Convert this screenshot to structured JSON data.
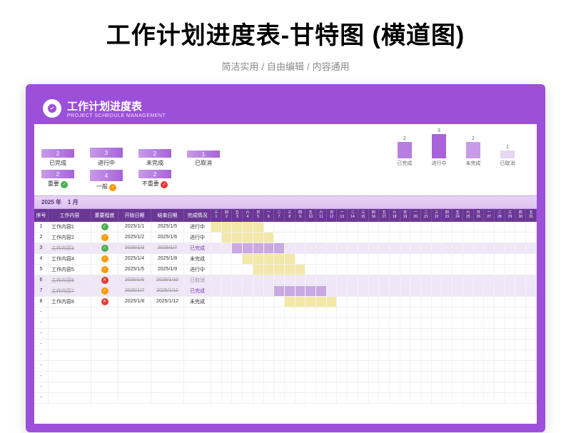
{
  "page": {
    "title": "工作计划进度表-甘特图 (横道图)",
    "subtitle": [
      "简洁实用",
      "自由编辑",
      "内容通用"
    ]
  },
  "header": {
    "title": "工作计划进度表",
    "subtitle": "PROJECT SCHEDULE MANAGEMENT"
  },
  "summary_status": [
    {
      "label": "已完成",
      "value": "2",
      "h": 12
    },
    {
      "label": "进行中",
      "value": "3",
      "h": 14
    },
    {
      "label": "未完成",
      "value": "2",
      "h": 12
    },
    {
      "label": "已取消",
      "value": "1",
      "h": 10
    }
  ],
  "summary_importance": [
    {
      "label": "重要",
      "value": "2",
      "h": 12,
      "icon": "green"
    },
    {
      "label": "一般",
      "value": "4",
      "h": 16,
      "icon": "orange"
    },
    {
      "label": "不重要",
      "value": "2",
      "h": 12,
      "icon": "red"
    }
  ],
  "chart_data": {
    "type": "bar",
    "categories": [
      "已完成",
      "进行中",
      "未完成",
      "已取消"
    ],
    "values": [
      2,
      3,
      2,
      1
    ],
    "title": "",
    "xlabel": "",
    "ylabel": "",
    "ylim": [
      0,
      3
    ]
  },
  "date_control": {
    "year": "2025",
    "year_label": "年",
    "month": "1",
    "month_label": "月"
  },
  "columns": {
    "idx": "序号",
    "task": "工作内容",
    "importance": "重要程度",
    "start": "开始日期",
    "end": "结束日期",
    "status": "完成情况"
  },
  "weekdays": [
    "三",
    "四",
    "五",
    "六",
    "日",
    "一",
    "二",
    "三",
    "四",
    "五",
    "六",
    "日",
    "一",
    "二",
    "三",
    "四",
    "五",
    "六",
    "日",
    "一",
    "二",
    "三",
    "四",
    "五",
    "六",
    "日",
    "一",
    "二",
    "三",
    "四",
    "五"
  ],
  "days": [
    "1",
    "2",
    "3",
    "4",
    "5",
    "6",
    "7",
    "8",
    "9",
    "10",
    "11",
    "12",
    "13",
    "14",
    "15",
    "16",
    "17",
    "18",
    "19",
    "20",
    "21",
    "22",
    "23",
    "24",
    "25",
    "26",
    "27",
    "28",
    "29",
    "30",
    "31"
  ],
  "rows": [
    {
      "idx": "1",
      "task": "工作内容1",
      "imp": "green",
      "start": "2025/1/1",
      "end": "2025/1/5",
      "status": "进行中",
      "statusCls": "prog",
      "gstart": 0,
      "gend": 5,
      "fill": "yellow",
      "alt": false
    },
    {
      "idx": "2",
      "task": "工作内容2",
      "imp": "orange",
      "start": "2025/1/2",
      "end": "2025/1/6",
      "status": "进行中",
      "statusCls": "prog",
      "gstart": 1,
      "gend": 6,
      "fill": "yellow",
      "alt": false
    },
    {
      "idx": "3",
      "task": "工作内容3",
      "imp": "green",
      "start": "2025/1/3",
      "end": "2025/1/7",
      "status": "已完成",
      "statusCls": "done",
      "gstart": 2,
      "gend": 7,
      "fill": "purple",
      "alt": true,
      "strike": true
    },
    {
      "idx": "4",
      "task": "工作内容4",
      "imp": "orange",
      "start": "2025/1/4",
      "end": "2025/1/8",
      "status": "未完成",
      "statusCls": "wait",
      "gstart": 3,
      "gend": 8,
      "fill": "yellow",
      "alt": false
    },
    {
      "idx": "5",
      "task": "工作内容5",
      "imp": "orange",
      "start": "2025/1/5",
      "end": "2025/1/9",
      "status": "进行中",
      "statusCls": "prog",
      "gstart": 4,
      "gend": 9,
      "fill": "yellow",
      "alt": false
    },
    {
      "idx": "6",
      "task": "工作内容6",
      "imp": "red",
      "start": "2025/1/6",
      "end": "2025/1/10",
      "status": "已取消",
      "statusCls": "cancel",
      "gstart": 5,
      "gend": 10,
      "fill": "",
      "alt": true,
      "strike": true
    },
    {
      "idx": "7",
      "task": "工作内容7",
      "imp": "orange",
      "start": "2025/1/7",
      "end": "2025/1/11",
      "status": "已完成",
      "statusCls": "done",
      "gstart": 6,
      "gend": 11,
      "fill": "purple",
      "alt": true,
      "strike": true
    },
    {
      "idx": "8",
      "task": "工作内容8",
      "imp": "red",
      "start": "2025/1/8",
      "end": "2025/1/12",
      "status": "未完成",
      "statusCls": "wait",
      "gstart": 7,
      "gend": 12,
      "fill": "yellow",
      "alt": false
    }
  ],
  "empty_rows": 9,
  "empty_placeholder": "-"
}
